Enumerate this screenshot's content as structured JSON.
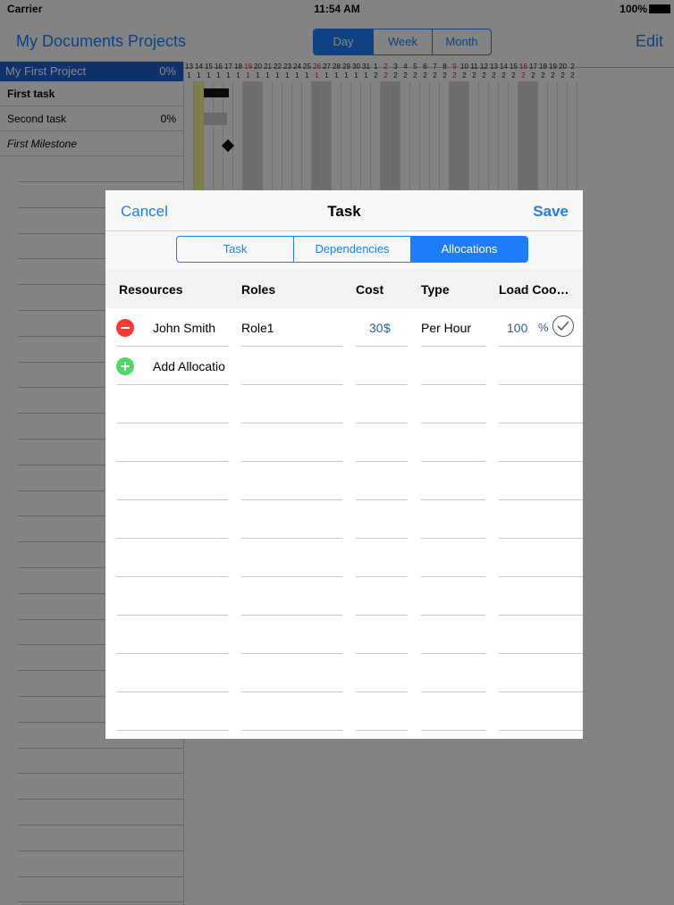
{
  "status_bar": {
    "carrier": "Carrier",
    "time": "11:54 AM",
    "battery": "100%"
  },
  "navbar": {
    "title": "My Documents  Projects",
    "edit": "Edit",
    "view_segments": [
      "Day",
      "Week",
      "Month"
    ]
  },
  "task_list": {
    "project": {
      "name": "My First Project",
      "percent": "0%"
    },
    "tasks": [
      {
        "name": "First task",
        "percent": ""
      },
      {
        "name": "Second task",
        "percent": "0%"
      },
      {
        "name": "First Milestone",
        "percent": ""
      }
    ]
  },
  "gantt": {
    "days": [
      {
        "d": "13",
        "r": "1",
        "red": false
      },
      {
        "d": "14",
        "r": "1",
        "red": false
      },
      {
        "d": "15",
        "r": "1",
        "red": false
      },
      {
        "d": "16",
        "r": "1",
        "red": false
      },
      {
        "d": "17",
        "r": "1",
        "red": false
      },
      {
        "d": "18",
        "r": "1",
        "red": false
      },
      {
        "d": "19",
        "r": "1",
        "red": true
      },
      {
        "d": "20",
        "r": "1",
        "red": false
      },
      {
        "d": "21",
        "r": "1",
        "red": false
      },
      {
        "d": "22",
        "r": "1",
        "red": false
      },
      {
        "d": "23",
        "r": "1",
        "red": false
      },
      {
        "d": "24",
        "r": "1",
        "red": false
      },
      {
        "d": "25",
        "r": "1",
        "red": false
      },
      {
        "d": "26",
        "r": "1",
        "red": true
      },
      {
        "d": "27",
        "r": "1",
        "red": false
      },
      {
        "d": "28",
        "r": "1",
        "red": false
      },
      {
        "d": "29",
        "r": "1",
        "red": false
      },
      {
        "d": "30",
        "r": "1",
        "red": false
      },
      {
        "d": "31",
        "r": "1",
        "red": false
      },
      {
        "d": "1",
        "r": "2",
        "red": false
      },
      {
        "d": "2",
        "r": "2",
        "red": true
      },
      {
        "d": "3",
        "r": "2",
        "red": false
      },
      {
        "d": "4",
        "r": "2",
        "red": false
      },
      {
        "d": "5",
        "r": "2",
        "red": false
      },
      {
        "d": "6",
        "r": "2",
        "red": false
      },
      {
        "d": "7",
        "r": "2",
        "red": false
      },
      {
        "d": "8",
        "r": "2",
        "red": false
      },
      {
        "d": "9",
        "r": "2",
        "red": true
      },
      {
        "d": "10",
        "r": "2",
        "red": false
      },
      {
        "d": "11",
        "r": "2",
        "red": false
      },
      {
        "d": "12",
        "r": "2",
        "red": false
      },
      {
        "d": "13",
        "r": "2",
        "red": false
      },
      {
        "d": "14",
        "r": "2",
        "red": false
      },
      {
        "d": "15",
        "r": "2",
        "red": false
      },
      {
        "d": "16",
        "r": "2",
        "red": true
      },
      {
        "d": "17",
        "r": "2",
        "red": false
      },
      {
        "d": "18",
        "r": "2",
        "red": false
      },
      {
        "d": "19",
        "r": "2",
        "red": false
      },
      {
        "d": "20",
        "r": "2",
        "red": false
      },
      {
        "d": "2",
        "r": "2",
        "red": false
      }
    ]
  },
  "modal": {
    "cancel": "Cancel",
    "title": "Task",
    "save": "Save",
    "segments": [
      "Task",
      "Dependencies",
      "Allocations"
    ],
    "selected_segment": "Allocations",
    "columns": {
      "resources": "Resources",
      "roles": "Roles",
      "cost": "Cost",
      "type": "Type",
      "load": "Load Coo…"
    },
    "allocations": [
      {
        "resource": "John Smith",
        "role": "Role1",
        "cost": "30",
        "currency": "$",
        "type": "Per Hour",
        "load": "100",
        "load_unit": "%"
      }
    ],
    "add_label": "Add Allocatio"
  },
  "colors": {
    "accent": "#1b7dfa",
    "remove": "#f43a32",
    "add": "#4cd964",
    "value_blue": "#2a5cab"
  }
}
